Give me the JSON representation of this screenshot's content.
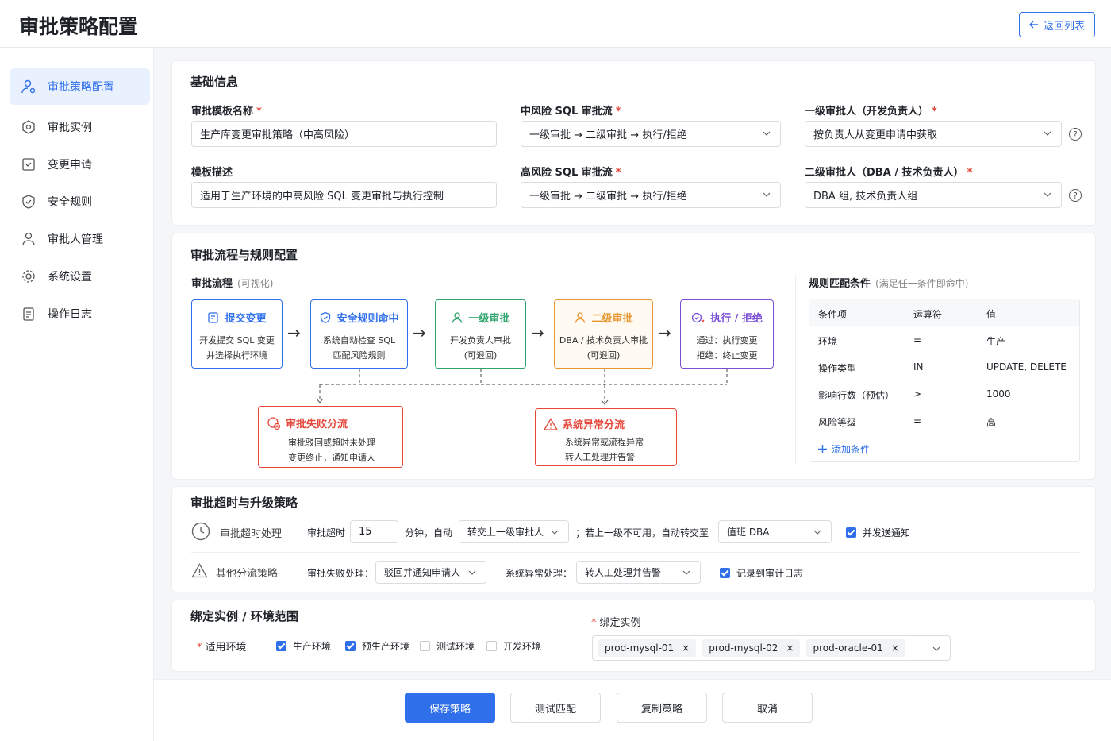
{
  "header": {
    "title": "审批策略配置",
    "back_label": "返回列表"
  },
  "sidebar": {
    "items": [
      {
        "label": "审批策略配置",
        "icon": "user-settings-icon",
        "active": true
      },
      {
        "label": "审批实例",
        "icon": "gear-hex-icon"
      },
      {
        "label": "变更申请",
        "icon": "checklist-icon"
      },
      {
        "label": "安全规则",
        "icon": "shield-icon"
      },
      {
        "label": "审批人管理",
        "icon": "person-icon"
      },
      {
        "label": "系统设置",
        "icon": "gear-icon"
      },
      {
        "label": "操作日志",
        "icon": "clipboard-icon"
      }
    ]
  },
  "basic": {
    "title": "基础信息",
    "template_name_label": "审批模板名称",
    "template_name_value": "生产库变更审批策略（中高风险）",
    "template_desc_label": "模板描述",
    "template_desc_value": "适用于生产环境的中高风险 SQL 变更审批与执行控制",
    "mid_flow_label": "中风险 SQL 审批流",
    "mid_flow_value": "一级审批 → 二级审批 → 执行/拒绝",
    "high_flow_label": "高风险 SQL 审批流",
    "high_flow_value": "一级审批 → 二级审批 → 执行/拒绝",
    "level1_label": "一级审批人（开发负责人）",
    "level1_value": "按负责人从变更申请中获取",
    "level2_label": "二级审批人（DBA / 技术负责人）",
    "level2_value": "DBA 组, 技术负责人组",
    "help_glyph": "?"
  },
  "flow": {
    "title": "审批流程与规则配置",
    "flow_label": "审批流程",
    "flow_sub": "(可视化)",
    "nodes": [
      {
        "title": "提交变更",
        "line1": "开发提交 SQL 变更",
        "line2": "并选择执行环境",
        "color": "#2f6fea"
      },
      {
        "title": "安全规则命中",
        "line1": "系统自动检查 SQL",
        "line2": "匹配风险规则",
        "color": "#2f6fea"
      },
      {
        "title": "一级审批",
        "line1": "开发负责人审批",
        "line2": "(可退回)",
        "color": "#2ea36b"
      },
      {
        "title": "二级审批",
        "line1": "DBA / 技术负责人审批",
        "line2": "(可退回)",
        "color": "#e8962f"
      },
      {
        "title": "执行 / 拒绝",
        "line1": "通过：执行变更",
        "line2": "拒绝：终止变更",
        "color": "#7a4fd6"
      }
    ],
    "fail_branch": {
      "title": "审批失败分流",
      "line1": "审批驳回或超时未处理",
      "line2": "变更终止，通知申请人"
    },
    "error_branch": {
      "title": "系统异常分流",
      "line1": "系统异常或流程异常",
      "line2": "转人工处理并告警"
    },
    "rules_label": "规则匹配条件",
    "rules_sub": "(满足任一条件即命中)",
    "rules_headers": [
      "条件项",
      "运算符",
      "值"
    ],
    "rules": [
      [
        "环境",
        "=",
        "生产"
      ],
      [
        "操作类型",
        "IN",
        "UPDATE, DELETE"
      ],
      [
        "影响行数（预估）",
        ">",
        "1000"
      ],
      [
        "风险等级",
        "=",
        "高"
      ]
    ],
    "add_condition": "添加条件"
  },
  "timeout": {
    "title": "审批超时与升级策略",
    "timeout_label": "审批超时处理",
    "timeout_prefix": "审批超时",
    "timeout_minutes": "15",
    "minutes_auto": "分钟，自动",
    "action_value": "转交上一级审批人",
    "fallback_text": "；若上一级不可用，自动转交至",
    "fallback_value": "值班 DBA",
    "notify_label": "并发送通知",
    "other_label": "其他分流策略",
    "fail_label": "审批失败处理：",
    "fail_value": "驳回并通知申请人",
    "error_label": "系统异常处理：",
    "error_value": "转人工处理并告警",
    "audit_label": "记录到审计日志"
  },
  "bind": {
    "title": "绑定实例 / 环境范围",
    "env_label": "适用环境",
    "envs": [
      {
        "label": "生产环境",
        "checked": true
      },
      {
        "label": "预生产环境",
        "checked": true
      },
      {
        "label": "测试环境",
        "checked": false
      },
      {
        "label": "开发环境",
        "checked": false
      }
    ],
    "instance_label": "绑定实例",
    "instances": [
      "prod-mysql-01",
      "prod-mysql-02",
      "prod-oracle-01"
    ]
  },
  "actions": {
    "save": "保存策略",
    "test": "测试匹配",
    "copy": "复制策略",
    "cancel": "取消"
  }
}
